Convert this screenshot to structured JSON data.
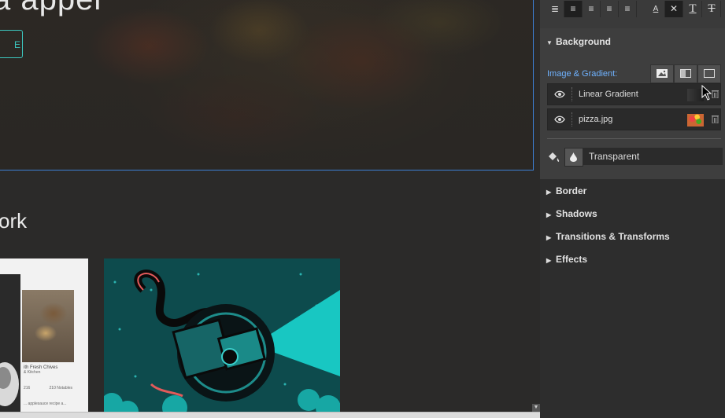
{
  "canvas": {
    "hero_heading": "a appel",
    "hero_button_label": "E",
    "section_heading": "ork",
    "food_card": {
      "title": "ith Fresh Chives",
      "subtitle": "& Kitchen",
      "stat_left": "216",
      "stat_right": "210 Notables",
      "footer": "... applesauce recipe a..."
    }
  },
  "inspector": {
    "toolbar": {
      "buttons": [
        {
          "name": "paragraph-spacing-icon",
          "glyph": "≣"
        },
        {
          "name": "align-left-icon",
          "glyph": "≡"
        },
        {
          "name": "align-center-icon",
          "glyph": "≡"
        },
        {
          "name": "align-right-icon",
          "glyph": "≡"
        },
        {
          "name": "align-justify-icon",
          "glyph": "≡"
        },
        {
          "name": "text-case-icon",
          "glyph": "A"
        },
        {
          "name": "clear-icon",
          "glyph": "✕"
        },
        {
          "name": "text-transform-icon",
          "glyph": "T"
        },
        {
          "name": "strikethrough-icon",
          "glyph": "T"
        }
      ]
    },
    "background": {
      "header": "Background",
      "gradient_label": "Image & Gradient:",
      "layers": [
        {
          "name": "Linear Gradient"
        },
        {
          "name": "pizza.jpg"
        }
      ],
      "fill_value": "Transparent"
    },
    "sections": [
      "Border",
      "Shadows",
      "Transitions & Transforms",
      "Effects"
    ]
  },
  "colors": {
    "accent_link": "#6fb2ff",
    "hero_button": "#3cc8c0",
    "selection_outline": "#3d7fd4"
  }
}
